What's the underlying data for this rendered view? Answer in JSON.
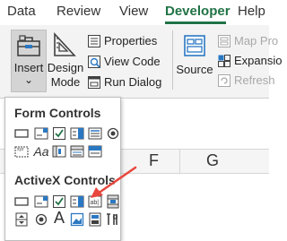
{
  "tabs": [
    {
      "label": "Data"
    },
    {
      "label": "Review"
    },
    {
      "label": "View"
    },
    {
      "label": "Developer"
    },
    {
      "label": "Help"
    }
  ],
  "ribbon": {
    "insert_line1": "Insert",
    "insert_line2": "⌄",
    "design_line1": "Design",
    "design_line2": "Mode",
    "properties": "Properties",
    "view_code": "View Code",
    "run_dialog": "Run Dialog",
    "source": "Source",
    "map_properties": "Map Pro",
    "expansion": "Expansio",
    "refresh": "Refresh"
  },
  "sheet": {
    "columns": [
      "F",
      "G"
    ]
  },
  "dropdown": {
    "form_controls": "Form Controls",
    "activex_controls": "ActiveX Controls",
    "label_glyph": "Aa",
    "activex_label_glyph": "A"
  },
  "colors": {
    "accent": "#217346",
    "arrow": "#e8473d",
    "icon_blue": "#2b78c2",
    "icon_dark": "#404040"
  }
}
